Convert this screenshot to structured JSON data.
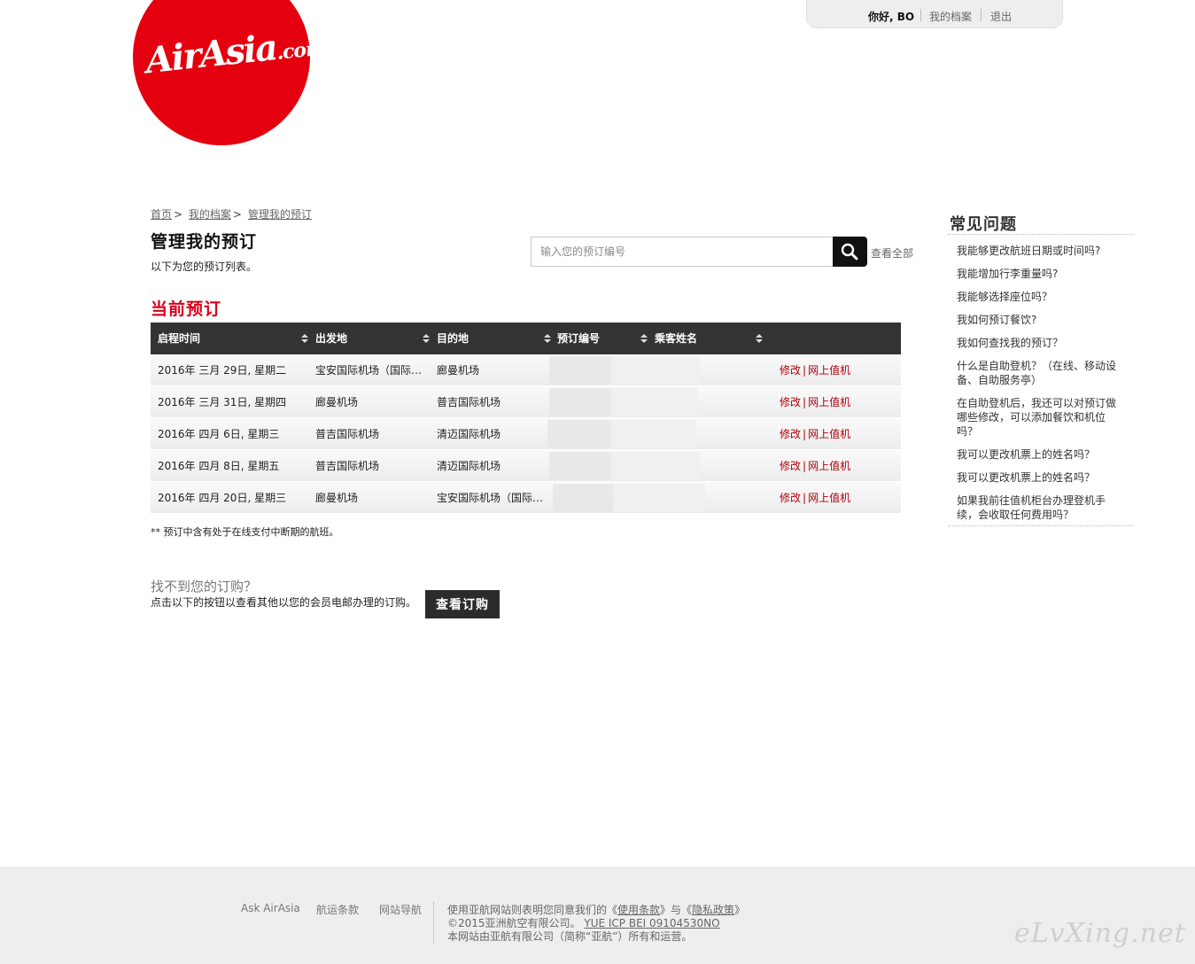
{
  "brand": {
    "logo_main": "AirAsia",
    "logo_suffix": ".com",
    "accent": "#e4000e",
    "link_red": "#b0000b"
  },
  "userbar": {
    "greeting_prefix": "你好,",
    "user_name": "BO",
    "profile_link": "我的档案",
    "logout_link": "退出"
  },
  "breadcrumb": {
    "home": "首页",
    "profile": "我的档案",
    "current": "管理我的预订"
  },
  "page": {
    "title": "管理我的预订",
    "description": "以下为您的预订列表。"
  },
  "search": {
    "placeholder": "输入您的预订编号",
    "view_all": "查看全部"
  },
  "current_bookings": {
    "title": "当前预订",
    "columns": [
      "启程时间",
      "出发地",
      "目的地",
      "预订编号",
      "乘客姓名"
    ],
    "rows": [
      {
        "date": "2016年 三月 29日, 星期二",
        "origin": "宝安国际机场（国际航站楼）",
        "destination": "廊曼机场"
      },
      {
        "date": "2016年 三月 31日, 星期四",
        "origin": "廊曼机场",
        "destination": "普吉国际机场"
      },
      {
        "date": "2016年 四月 6日, 星期三",
        "origin": "普吉国际机场",
        "destination": "清迈国际机场"
      },
      {
        "date": "2016年 四月 8日, 星期五",
        "origin": "普吉国际机场",
        "destination": "清迈国际机场"
      },
      {
        "date": "2016年 四月 20日, 星期三",
        "origin": "廊曼机场",
        "destination": "宝安国际机场（国际航站楼）"
      }
    ],
    "action_modify": "修改",
    "action_separator": "|",
    "action_checkin": "网上值机",
    "note": "** 预订中含有处于在线支付中断期的航班。"
  },
  "cannot_find": {
    "title": "找不到您的订购？",
    "description": "点击以下的按钮以查看其他以您的会员电邮办理的订购。",
    "button": "查看订购"
  },
  "faq": {
    "title": "常见问题",
    "items": [
      "我能够更改航班日期或时间吗?",
      "我能增加行李重量吗?",
      "我能够选择座位吗？",
      "我如何预订餐饮?",
      "我如何查找我的预订？",
      "什么是自助登机？（在线、移动设备、自助服务亭）",
      "在自助登机后，我还可以对预订做哪些修改，可以添加餐饮和机位吗？",
      "我可以更改机票上的姓名吗？",
      "我可以更改机票上的姓名吗？",
      "如果我前往值机柜台办理登机手续，会收取任何费用吗？"
    ]
  },
  "footer": {
    "nav": [
      "Ask AirAsia",
      "航运条款",
      "网站导航"
    ],
    "line1_prefix": "使用亚航网站则表明您同意我们的《",
    "terms": "使用条款",
    "line1_mid": "》与《",
    "privacy": "隐私政策",
    "line1_suffix": "》",
    "line2_prefix": "©2015亚洲航空有限公司。",
    "icp": "YUE ICP BEI 09104530NO",
    "line3": "本网站由亚航有限公司（简称“亚航”）所有和运营。",
    "watermark": "eLvXing.net"
  }
}
